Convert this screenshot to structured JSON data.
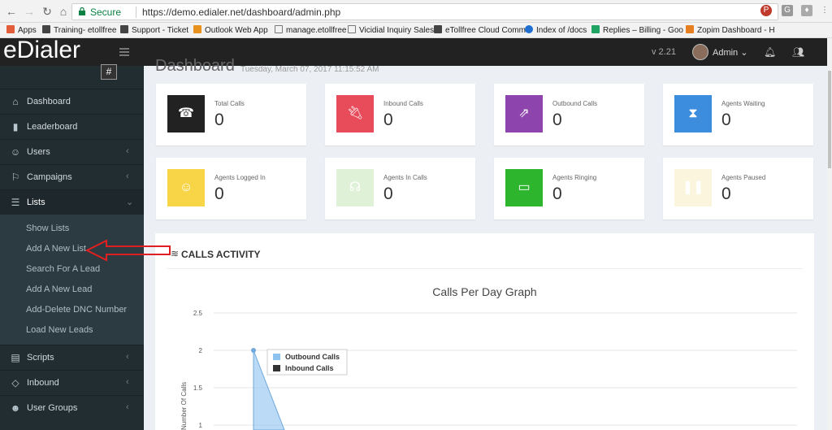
{
  "browser": {
    "secure_label": "Secure",
    "url": "https://demo.edialer.net/dashboard/admin.php"
  },
  "bookmarks": [
    {
      "label": "Apps"
    },
    {
      "label": "Training- etollfree"
    },
    {
      "label": "Support - Ticket"
    },
    {
      "label": "Outlook Web App"
    },
    {
      "label": "manage.etollfree"
    },
    {
      "label": "Vicidial Inquiry Sales"
    },
    {
      "label": "eTollfree Cloud Comm"
    },
    {
      "label": "Index of /docs"
    },
    {
      "label": "Replies – Billing - Goo"
    },
    {
      "label": "Zopim Dashboard - H"
    }
  ],
  "topbar": {
    "logo": "eDialer",
    "logo_badge": "#",
    "version": "v 2.21",
    "user": "Admin ⌄"
  },
  "sidebar": {
    "items": [
      {
        "label": "Dashboard",
        "icon": "home-icon"
      },
      {
        "label": "Leaderboard",
        "icon": "bar-chart-icon"
      },
      {
        "label": "Users",
        "icon": "users-icon",
        "chevron": "‹"
      },
      {
        "label": "Campaigns",
        "icon": "flag-icon",
        "chevron": "‹"
      },
      {
        "label": "Lists",
        "icon": "list-icon",
        "chevron": "⌄"
      },
      {
        "label": "Scripts",
        "icon": "file-icon",
        "chevron": "‹"
      },
      {
        "label": "Inbound",
        "icon": "diamond-icon",
        "chevron": "‹"
      },
      {
        "label": "User Groups",
        "icon": "user-groups-icon",
        "chevron": "‹"
      }
    ],
    "submenu": [
      {
        "label": "Show Lists"
      },
      {
        "label": "Add A New List"
      },
      {
        "label": "Search For A Lead"
      },
      {
        "label": "Add A New Lead"
      },
      {
        "label": "Add-Delete DNC Number"
      },
      {
        "label": "Load New Leads"
      }
    ]
  },
  "dashboard": {
    "title": "Dashboard",
    "datetime": "Tuesday, March 07, 2017 11:15:52 AM"
  },
  "cards": [
    {
      "label": "Total Calls",
      "value": "0",
      "color": "#222222",
      "icon": "phone-icon"
    },
    {
      "label": "Inbound Calls",
      "value": "0",
      "color": "#e84c5b",
      "icon": "plug-icon"
    },
    {
      "label": "Outbound Calls",
      "value": "0",
      "color": "#8e44ad",
      "icon": "external-link-icon"
    },
    {
      "label": "Agents Waiting",
      "value": "0",
      "color": "#3c8dde",
      "icon": "hourglass-icon"
    },
    {
      "label": "Agents Logged In",
      "value": "0",
      "color": "#f7d547",
      "icon": "user-icon"
    },
    {
      "label": "Agents In Calls",
      "value": "0",
      "color": "#dff2d8",
      "icon": "headset-icon"
    },
    {
      "label": "Agents Ringing",
      "value": "0",
      "color": "#2db52d",
      "icon": "monitor-icon"
    },
    {
      "label": "Agents Paused",
      "value": "0",
      "color": "#faf5dc",
      "icon": "pause-icon"
    }
  ],
  "calls_activity": {
    "title": "CALLS ACTIVITY"
  },
  "chart_data": {
    "type": "area",
    "title": "Calls Per Day Graph",
    "ylabel": "Number Of Calls",
    "yticks": [
      "2.5",
      "2",
      "1.5",
      "1"
    ],
    "ylim": [
      1,
      2.5
    ],
    "legend_placement": "top-left",
    "series": [
      {
        "name": "Outbound Calls",
        "color": "#8ec2ef",
        "values": [
          2
        ]
      },
      {
        "name": "Inbound Calls",
        "color": "#333333",
        "values": []
      }
    ]
  }
}
